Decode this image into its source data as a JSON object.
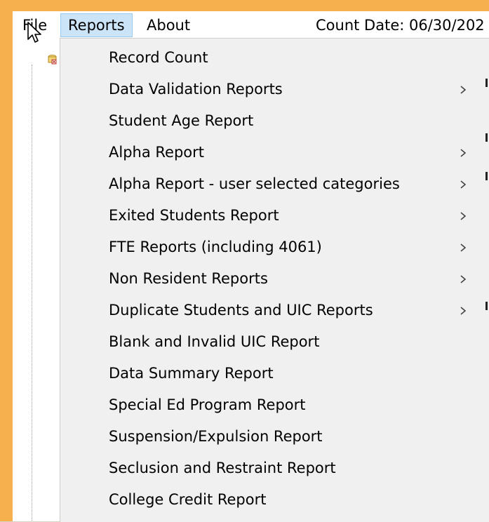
{
  "menubar": {
    "file_label": "File",
    "reports_label": "Reports",
    "about_label": "About",
    "count_date": "Count Date: 06/30/202"
  },
  "reports_menu": {
    "items": [
      {
        "label": "Record Count",
        "has_submenu": false
      },
      {
        "label": "Data Validation Reports",
        "has_submenu": true
      },
      {
        "label": "Student Age Report",
        "has_submenu": false
      },
      {
        "label": "Alpha Report",
        "has_submenu": true
      },
      {
        "label": "Alpha Report - user selected categories",
        "has_submenu": true
      },
      {
        "label": "Exited Students Report",
        "has_submenu": true
      },
      {
        "label": "FTE Reports (including 4061)",
        "has_submenu": true
      },
      {
        "label": "Non Resident Reports",
        "has_submenu": true
      },
      {
        "label": "Duplicate Students and UIC Reports",
        "has_submenu": true
      },
      {
        "label": "Blank and Invalid UIC Report",
        "has_submenu": false
      },
      {
        "label": "Data Summary Report",
        "has_submenu": false
      },
      {
        "label": "Special Ed Program Report",
        "has_submenu": false
      },
      {
        "label": "Suspension/Expulsion Report",
        "has_submenu": false
      },
      {
        "label": "Seclusion and Restraint Report",
        "has_submenu": false
      },
      {
        "label": "College Credit Report",
        "has_submenu": false
      }
    ]
  },
  "icons": {
    "submenu_arrow": "chevron-right-icon",
    "cursor": "mouse-pointer-icon",
    "tree_node": "database-icon"
  },
  "colors": {
    "frame": "#f6b04e",
    "menu_background": "#f0f0f0",
    "menubar_highlight": "#cce4f7",
    "menubar_highlight_border": "#99c9ef"
  }
}
